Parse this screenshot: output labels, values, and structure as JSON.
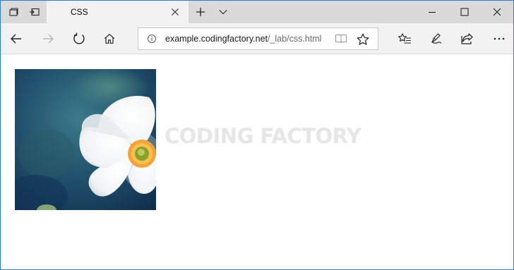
{
  "tab": {
    "title": "CSS"
  },
  "address_bar": {
    "host": "example.codingfactory.net",
    "path": "/_lab/css.html"
  },
  "page": {
    "watermark_text": "CODING FACTORY"
  },
  "icons": {
    "tab_preview": "tab-preview-icon",
    "set_tabs_aside": "set-tabs-aside-icon",
    "close_tab": "close-icon",
    "new_tab": "plus-icon",
    "tab_menu": "chevron-down-icon",
    "minimize": "minimize-icon",
    "maximize": "maximize-icon",
    "close_window": "close-icon",
    "back": "arrow-left-icon",
    "forward": "arrow-right-icon",
    "refresh": "refresh-icon",
    "home": "home-icon",
    "site_info": "info-icon",
    "reading_view": "book-icon",
    "favorite": "star-icon",
    "favorites_hub": "favorites-list-icon",
    "web_note": "pen-icon",
    "share": "share-icon",
    "more": "more-icon"
  },
  "colors": {
    "window_border": "#2b7fd6",
    "tab_strip": "#dadada",
    "nav_bar": "#f2f2f2",
    "watermark": "#e6e6e6"
  }
}
